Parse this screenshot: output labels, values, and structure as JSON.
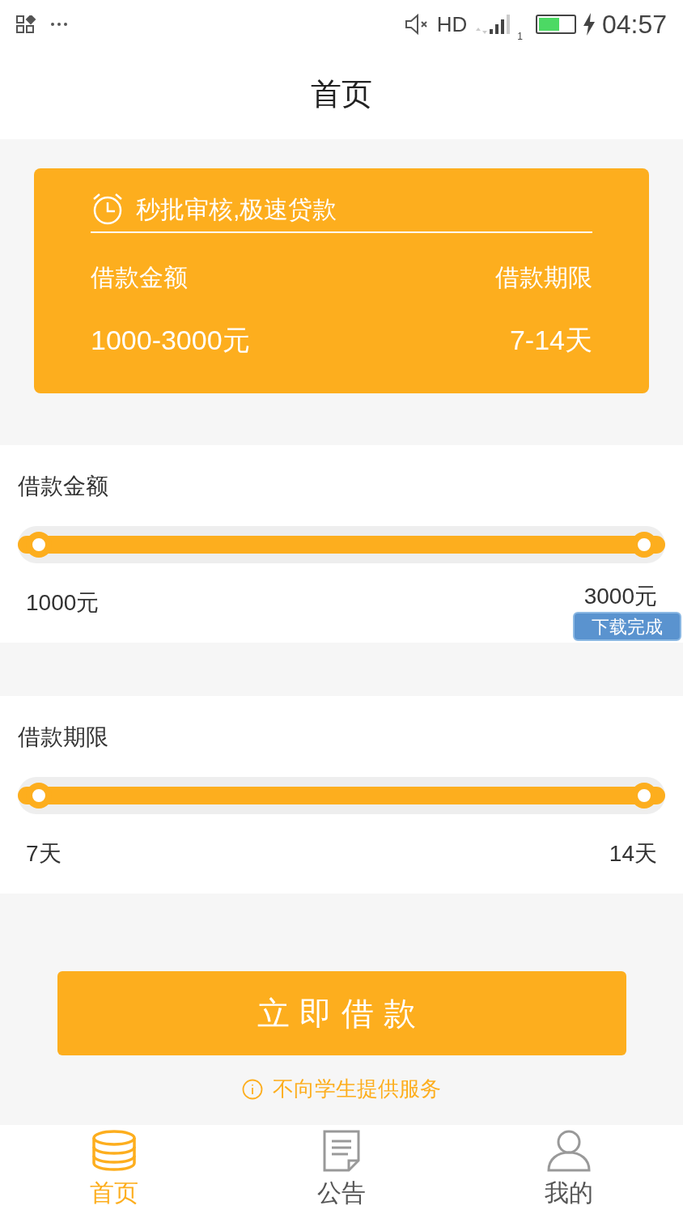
{
  "status_bar": {
    "network": "HD",
    "sim": "1",
    "time": "04:57"
  },
  "title": "首页",
  "banner": {
    "heading": "秒批审核,极速贷款",
    "left_label": "借款金额",
    "right_label": "借款期限",
    "left_value": "1000-3000元",
    "right_value": "7-14天"
  },
  "sliders": [
    {
      "label": "借款金额",
      "level": 1,
      "min": "1000元",
      "max": "3000元"
    },
    {
      "label": "借款期限",
      "level": 1,
      "min": "7天",
      "max": "14天"
    }
  ],
  "toast": {
    "text": "下载完成"
  },
  "submit_button": "立即借款",
  "notice": "不向学生提供服务",
  "tab_bar": [
    {
      "label": "首页",
      "kind": "coins",
      "selected": true
    },
    {
      "label": "公告",
      "kind": "notice",
      "selected": false
    },
    {
      "label": "我的",
      "kind": "person",
      "selected": false
    }
  ]
}
